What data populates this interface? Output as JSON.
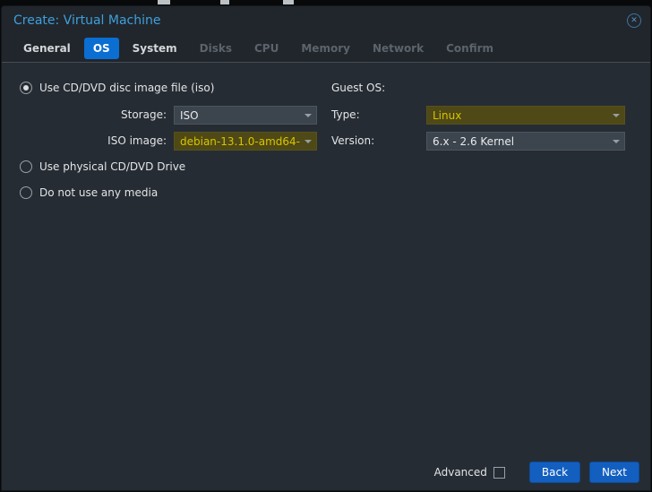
{
  "window": {
    "title": "Create: Virtual Machine"
  },
  "icons": {
    "close": "✕"
  },
  "tabs": [
    {
      "label": "General",
      "state": "enabled"
    },
    {
      "label": "OS",
      "state": "active"
    },
    {
      "label": "System",
      "state": "enabled"
    },
    {
      "label": "Disks",
      "state": "disabled"
    },
    {
      "label": "CPU",
      "state": "disabled"
    },
    {
      "label": "Memory",
      "state": "disabled"
    },
    {
      "label": "Network",
      "state": "disabled"
    },
    {
      "label": "Confirm",
      "state": "disabled"
    }
  ],
  "media": {
    "radio_iso_label": "Use CD/DVD disc image file (iso)",
    "radio_iso_selected": true,
    "storage_label": "Storage:",
    "storage_value": "ISO",
    "iso_image_label": "ISO image:",
    "iso_image_value": "debian-13.1.0-amd64-",
    "radio_physical_label": "Use physical CD/DVD Drive",
    "radio_physical_selected": false,
    "radio_none_label": "Do not use any media",
    "radio_none_selected": false
  },
  "guest_os": {
    "heading": "Guest OS:",
    "type_label": "Type:",
    "type_value": "Linux",
    "version_label": "Version:",
    "version_value": "6.x - 2.6 Kernel"
  },
  "footer": {
    "advanced_label": "Advanced",
    "advanced_checked": false,
    "back_label": "Back",
    "next_label": "Next"
  },
  "colors": {
    "accent_blue": "#0a6ed2",
    "title_blue": "#3da0dd",
    "button_blue": "#135fc0",
    "highlight_bg": "#4e4916",
    "highlight_text": "#d9c400",
    "dialog_bg": "#262c33",
    "bar_bg": "#21262c",
    "field_bg": "#3c444d"
  }
}
